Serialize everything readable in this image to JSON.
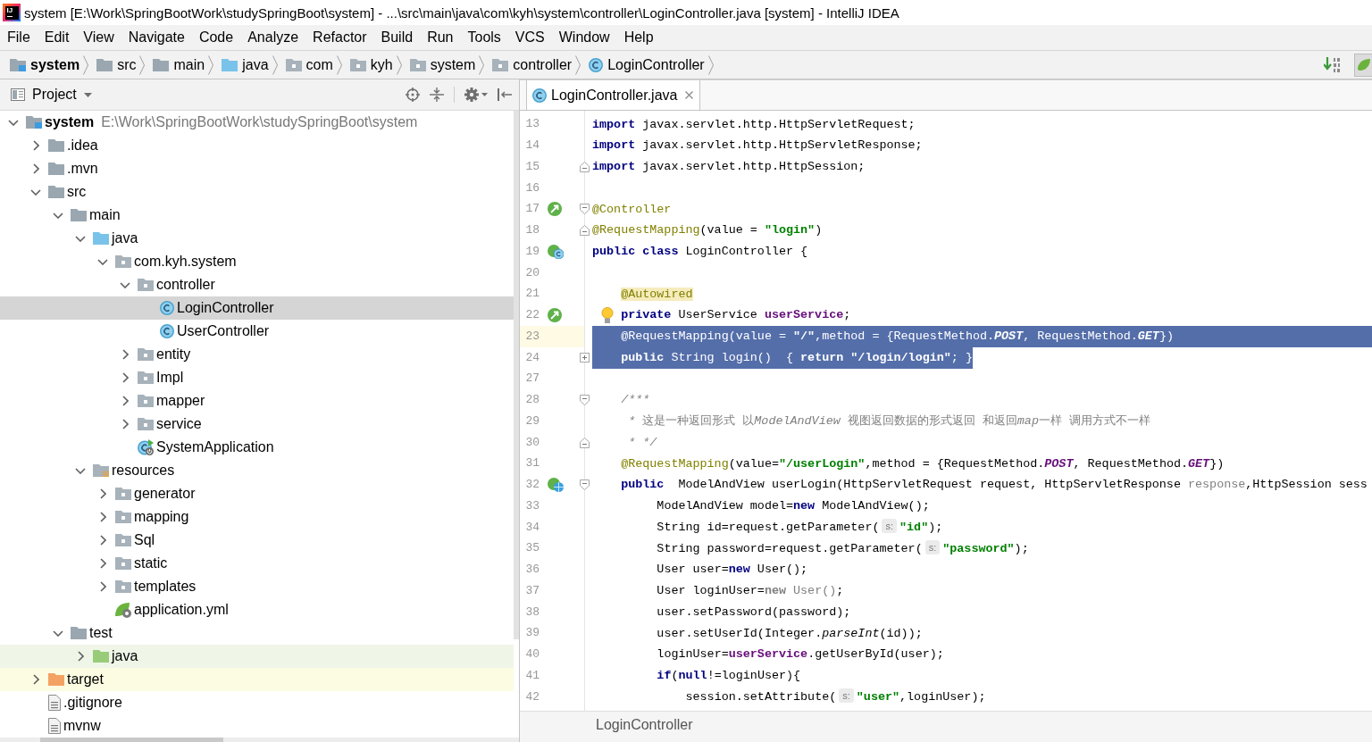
{
  "window": {
    "logo": "IJ",
    "title": "system [E:\\Work\\SpringBootWork\\studySpringBoot\\system] - ...\\src\\main\\java\\com\\kyh\\system\\controller\\LoginController.java [system] - IntelliJ IDEA"
  },
  "menu": [
    {
      "label": "File"
    },
    {
      "label": "Edit"
    },
    {
      "label": "View"
    },
    {
      "label": "Navigate"
    },
    {
      "label": "Code"
    },
    {
      "label": "Analyze"
    },
    {
      "label": "Refactor"
    },
    {
      "label": "Build"
    },
    {
      "label": "Run"
    },
    {
      "label": "Tools"
    },
    {
      "label": "VCS"
    },
    {
      "label": "Window"
    },
    {
      "label": "Help"
    }
  ],
  "navbar": {
    "items": [
      {
        "label": "system",
        "kind": "module"
      },
      {
        "label": "src",
        "kind": "folder"
      },
      {
        "label": "main",
        "kind": "folder"
      },
      {
        "label": "java",
        "kind": "source"
      },
      {
        "label": "com",
        "kind": "package"
      },
      {
        "label": "kyh",
        "kind": "package"
      },
      {
        "label": "system",
        "kind": "package"
      },
      {
        "label": "controller",
        "kind": "package"
      },
      {
        "label": "LoginController",
        "kind": "class"
      }
    ]
  },
  "project_panel": {
    "title": "Project",
    "tree": [
      {
        "label": "system",
        "path": "E:\\Work\\SpringBootWork\\studySpringBoot\\system",
        "kind": "module",
        "expanded": true,
        "selected": false,
        "children": [
          {
            "label": ".idea",
            "kind": "folder",
            "expanded": false,
            "selected": false
          },
          {
            "label": ".mvn",
            "kind": "folder",
            "expanded": false,
            "selected": false
          },
          {
            "label": "src",
            "kind": "folder",
            "expanded": true,
            "selected": false,
            "children": [
              {
                "label": "main",
                "kind": "folder",
                "expanded": true,
                "selected": false,
                "children": [
                  {
                    "label": "java",
                    "kind": "source",
                    "expanded": true,
                    "selected": false,
                    "children": [
                      {
                        "label": "com.kyh.system",
                        "kind": "package",
                        "expanded": true,
                        "selected": false,
                        "children": [
                          {
                            "label": "controller",
                            "kind": "package",
                            "expanded": true,
                            "selected": false,
                            "children": [
                              {
                                "label": "LoginController",
                                "kind": "class",
                                "selected": true
                              },
                              {
                                "label": "UserController",
                                "kind": "class",
                                "selected": false
                              }
                            ]
                          },
                          {
                            "label": "entity",
                            "kind": "package",
                            "expanded": false,
                            "selected": false
                          },
                          {
                            "label": "Impl",
                            "kind": "package",
                            "expanded": false,
                            "selected": false
                          },
                          {
                            "label": "mapper",
                            "kind": "package",
                            "expanded": false,
                            "selected": false
                          },
                          {
                            "label": "service",
                            "kind": "package",
                            "expanded": false,
                            "selected": false
                          },
                          {
                            "label": "SystemApplication",
                            "kind": "boot",
                            "selected": false
                          }
                        ]
                      }
                    ]
                  },
                  {
                    "label": "resources",
                    "kind": "resources",
                    "expanded": true,
                    "selected": false,
                    "children": [
                      {
                        "label": "generator",
                        "kind": "package",
                        "expanded": false,
                        "selected": false
                      },
                      {
                        "label": "mapping",
                        "kind": "package",
                        "expanded": false,
                        "selected": false
                      },
                      {
                        "label": "Sql",
                        "kind": "package",
                        "expanded": false,
                        "selected": false
                      },
                      {
                        "label": "static",
                        "kind": "package",
                        "expanded": false,
                        "selected": false
                      },
                      {
                        "label": "templates",
                        "kind": "package",
                        "expanded": false,
                        "selected": false
                      },
                      {
                        "label": "application.yml",
                        "kind": "config",
                        "selected": false
                      }
                    ]
                  }
                ]
              },
              {
                "label": "test",
                "kind": "folder",
                "expanded": true,
                "selected": false,
                "children": [
                  {
                    "label": "java",
                    "kind": "test",
                    "expanded": false,
                    "selected": false
                  }
                ]
              }
            ]
          },
          {
            "label": "target",
            "kind": "excluded",
            "expanded": false,
            "selected": false
          },
          {
            "label": ".gitignore",
            "kind": "file",
            "selected": false
          },
          {
            "label": "mvnw",
            "kind": "file",
            "selected": false
          }
        ]
      }
    ]
  },
  "editor": {
    "tabs": [
      {
        "label": "LoginController.java",
        "kind": "class",
        "selected": true
      }
    ],
    "lines": [
      {
        "number": "13",
        "selected": false,
        "tokens": [
          {
            "kind": "keyword",
            "text": "import"
          },
          {
            "kind": "plain",
            "text": " javax.servlet.http.HttpServletRequest;"
          }
        ]
      },
      {
        "number": "14",
        "selected": false,
        "tokens": [
          {
            "kind": "keyword",
            "text": "import"
          },
          {
            "kind": "plain",
            "text": " javax.servlet.http.HttpServletResponse;"
          }
        ]
      },
      {
        "number": "15",
        "selected": false,
        "fold": {
          "kind": "end"
        },
        "tokens": [
          {
            "kind": "keyword",
            "text": "import"
          },
          {
            "kind": "plain",
            "text": " javax.servlet.http.HttpSession;"
          }
        ]
      },
      {
        "number": "16",
        "selected": false
      },
      {
        "number": "17",
        "selected": false,
        "gutter": {
          "kind": "bean"
        },
        "fold": {
          "kind": "start"
        },
        "tokens": [
          {
            "kind": "annotation",
            "text": "@Controller"
          }
        ]
      },
      {
        "number": "18",
        "selected": false,
        "fold": {
          "kind": "end"
        },
        "tokens": [
          {
            "kind": "annotation",
            "text": "@RequestMapping"
          },
          {
            "kind": "plain",
            "text": "(value = "
          },
          {
            "kind": "string",
            "text": "\"login\""
          },
          {
            "kind": "plain",
            "text": ")"
          }
        ]
      },
      {
        "number": "19",
        "selected": false,
        "gutter": {
          "kind": "beanclass"
        },
        "tokens": [
          {
            "kind": "keyword",
            "text": "public class"
          },
          {
            "kind": "plain",
            "text": " LoginController {"
          }
        ]
      },
      {
        "number": "20",
        "selected": false
      },
      {
        "number": "21",
        "selected": false,
        "tokens": [
          {
            "kind": "warning",
            "text": "    @Autowired"
          }
        ]
      },
      {
        "number": "22",
        "selected": false,
        "gutter": {
          "kind": "bean"
        },
        "bulb": true,
        "tokens": [
          {
            "kind": "keyword",
            "text": "    private"
          },
          {
            "kind": "plain",
            "text": " UserService "
          },
          {
            "kind": "field",
            "text": "userService"
          },
          {
            "kind": "plain",
            "text": ";"
          }
        ]
      },
      {
        "number": "23",
        "selected": true,
        "current": true,
        "tokens": [
          {
            "kind": "annotation",
            "text": "    @RequestMapping"
          },
          {
            "kind": "plain",
            "text": "(value = "
          },
          {
            "kind": "string",
            "text": "\"/\""
          },
          {
            "kind": "plain",
            "text": ",method = {RequestMethod."
          },
          {
            "kind": "constant",
            "text": "POST"
          },
          {
            "kind": "plain",
            "text": ", RequestMethod."
          },
          {
            "kind": "constant",
            "text": "GET"
          },
          {
            "kind": "plain",
            "text": "})"
          }
        ]
      },
      {
        "number": "24",
        "selected": true,
        "fold": {
          "kind": "collapsed"
        },
        "tokens": [
          {
            "kind": "keyword",
            "text": "    public"
          },
          {
            "kind": "plain",
            "text": " String login()  { "
          },
          {
            "kind": "keyword",
            "text": "return "
          },
          {
            "kind": "string",
            "text": "\"/login/login\""
          },
          {
            "kind": "plain",
            "text": "; }"
          }
        ]
      },
      {
        "number": "27",
        "selected": false
      },
      {
        "number": "28",
        "selected": false,
        "fold": {
          "kind": "start"
        },
        "tokens": [
          {
            "kind": "comment",
            "text": "    /***"
          }
        ]
      },
      {
        "number": "29",
        "selected": false,
        "tokens": [
          {
            "kind": "comment",
            "text": "     * "
          },
          {
            "kind": "doc",
            "text": "这是一种返回形式 以"
          },
          {
            "kind": "comment",
            "text": "ModelAndView"
          },
          {
            "kind": "doc",
            "text": " 视图返回数据的形式返回 和返回"
          },
          {
            "kind": "comment",
            "text": "map"
          },
          {
            "kind": "doc",
            "text": "一样 调用方式不一样"
          }
        ]
      },
      {
        "number": "30",
        "selected": false,
        "fold": {
          "kind": "end"
        },
        "tokens": [
          {
            "kind": "comment",
            "text": "     * */"
          }
        ]
      },
      {
        "number": "31",
        "selected": false,
        "tokens": [
          {
            "kind": "annotation",
            "text": "    @RequestMapping"
          },
          {
            "kind": "plain",
            "text": "(value="
          },
          {
            "kind": "string",
            "text": "\"/userLogin\""
          },
          {
            "kind": "plain",
            "text": ",method = {RequestMethod."
          },
          {
            "kind": "constant",
            "text": "POST"
          },
          {
            "kind": "plain",
            "text": ", RequestMethod."
          },
          {
            "kind": "constant",
            "text": "GET"
          },
          {
            "kind": "plain",
            "text": "})"
          }
        ]
      },
      {
        "number": "32",
        "selected": false,
        "gutter": {
          "kind": "web"
        },
        "fold": {
          "kind": "start"
        },
        "tokens": [
          {
            "kind": "keyword",
            "text": "    public"
          },
          {
            "kind": "plain",
            "text": "  ModelAndView userLogin(HttpServletRequest request, HttpServletResponse "
          },
          {
            "kind": "unused",
            "text": "response"
          },
          {
            "kind": "plain",
            "text": ",HttpSession sess"
          }
        ]
      },
      {
        "number": "33",
        "selected": false,
        "tokens": [
          {
            "kind": "plain",
            "text": "         ModelAndView model="
          },
          {
            "kind": "keyword",
            "text": "new"
          },
          {
            "kind": "plain",
            "text": " ModelAndView();"
          }
        ]
      },
      {
        "number": "34",
        "selected": false,
        "tokens": [
          {
            "kind": "plain",
            "text": "         String id=request.getParameter("
          },
          {
            "kind": "hint",
            "text": "s:"
          },
          {
            "kind": "string",
            "text": "\"id\""
          },
          {
            "kind": "plain",
            "text": ");"
          }
        ]
      },
      {
        "number": "35",
        "selected": false,
        "tokens": [
          {
            "kind": "plain",
            "text": "         String password=request.getParameter("
          },
          {
            "kind": "hint",
            "text": "s:"
          },
          {
            "kind": "string",
            "text": "\"password\""
          },
          {
            "kind": "plain",
            "text": ");"
          }
        ]
      },
      {
        "number": "36",
        "selected": false,
        "tokens": [
          {
            "kind": "plain",
            "text": "         User user="
          },
          {
            "kind": "keyword",
            "text": "new"
          },
          {
            "kind": "plain",
            "text": " User();"
          }
        ]
      },
      {
        "number": "37",
        "selected": false,
        "tokens": [
          {
            "kind": "plain",
            "text": "         User loginUser="
          },
          {
            "kind": "unusedkw",
            "text": "new"
          },
          {
            "kind": "unused",
            "text": " User()"
          },
          {
            "kind": "plain",
            "text": ";"
          }
        ]
      },
      {
        "number": "38",
        "selected": false,
        "tokens": [
          {
            "kind": "plain",
            "text": "         user.setPassword(password);"
          }
        ]
      },
      {
        "number": "39",
        "selected": false,
        "tokens": [
          {
            "kind": "plain",
            "text": "         user.setUserId(Integer."
          },
          {
            "kind": "italic",
            "text": "parseInt"
          },
          {
            "kind": "plain",
            "text": "(id));"
          }
        ]
      },
      {
        "number": "40",
        "selected": false,
        "tokens": [
          {
            "kind": "plain",
            "text": "         loginUser="
          },
          {
            "kind": "field",
            "text": "userService"
          },
          {
            "kind": "plain",
            "text": ".getUserById(user);"
          }
        ]
      },
      {
        "number": "41",
        "selected": false,
        "tokens": [
          {
            "kind": "keyword",
            "text": "         if"
          },
          {
            "kind": "plain",
            "text": "("
          },
          {
            "kind": "keyword",
            "text": "null"
          },
          {
            "kind": "plain",
            "text": "!=loginUser){"
          }
        ]
      },
      {
        "number": "42",
        "selected": false,
        "tokens": [
          {
            "kind": "plain",
            "text": "             session.setAttribute("
          },
          {
            "kind": "hint",
            "text": "s:"
          },
          {
            "kind": "string",
            "text": "\"user\""
          },
          {
            "kind": "plain",
            "text": ",loginUser);"
          }
        ]
      }
    ],
    "breadcrumb": "LoginController"
  }
}
